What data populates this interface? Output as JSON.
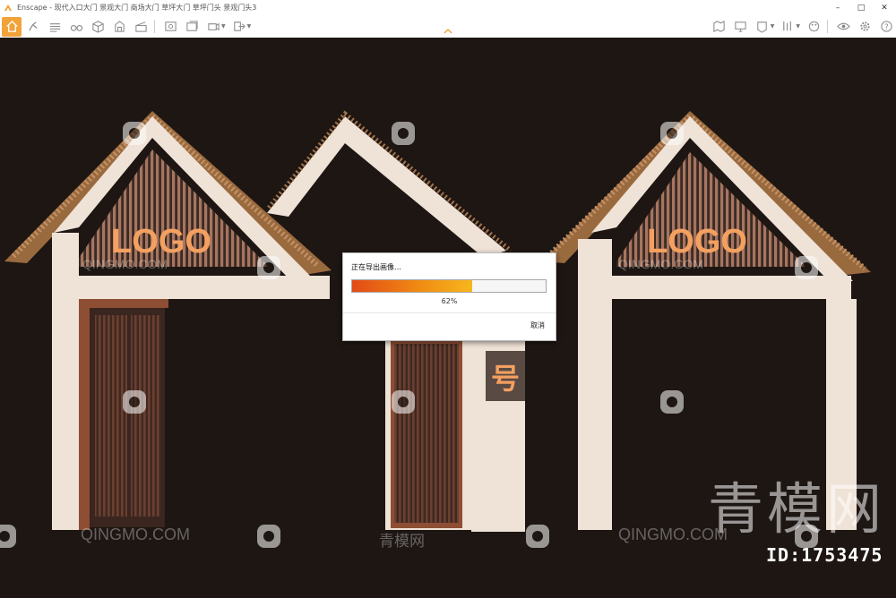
{
  "window": {
    "app_name": "Enscape",
    "title": "Enscape - 现代入口大门 景观大门 商场大门 草坪大门 草坪门头 景观门头3",
    "minimize": "–",
    "maximize": "□",
    "close": "✕"
  },
  "toolbar": {
    "buttons": [
      {
        "icon": "home-icon",
        "active": true
      },
      {
        "icon": "walk-mode-icon"
      },
      {
        "icon": "bim-icon",
        "text": "BIM"
      },
      {
        "icon": "binoculars-icon"
      },
      {
        "icon": "cube-icon"
      },
      {
        "icon": "asset-library-icon"
      },
      {
        "icon": "clapboard-icon"
      },
      {
        "icon": "screenshot-icon"
      },
      {
        "icon": "batch-render-icon"
      },
      {
        "icon": "video-path-icon"
      },
      {
        "icon": "export-icon"
      },
      {
        "icon": "map-icon"
      },
      {
        "icon": "monitor-icon"
      },
      {
        "icon": "vr-headset-icon"
      },
      {
        "icon": "binoculars-vr-icon"
      },
      {
        "icon": "palette-icon"
      },
      {
        "icon": "eye-icon"
      },
      {
        "icon": "settings-gear-icon"
      },
      {
        "icon": "help-icon"
      }
    ]
  },
  "dialog": {
    "heading": "正在导出画像…",
    "progress": 0.62,
    "progress_text": "62%",
    "cancel_label": "取消"
  },
  "scene": {
    "logo_text": "LOGO",
    "sign_text": "号"
  },
  "watermark": {
    "brand_cn": "青模网",
    "brand_en": "QINGMO.COM",
    "big_text": "青模网",
    "id_text": "ID:1753475"
  },
  "colors": {
    "accent": "#f1a33a",
    "background": "#1d1613",
    "progress_start": "#e34a17",
    "progress_end": "#f7b71d",
    "logo_orange": "#f3a060"
  }
}
